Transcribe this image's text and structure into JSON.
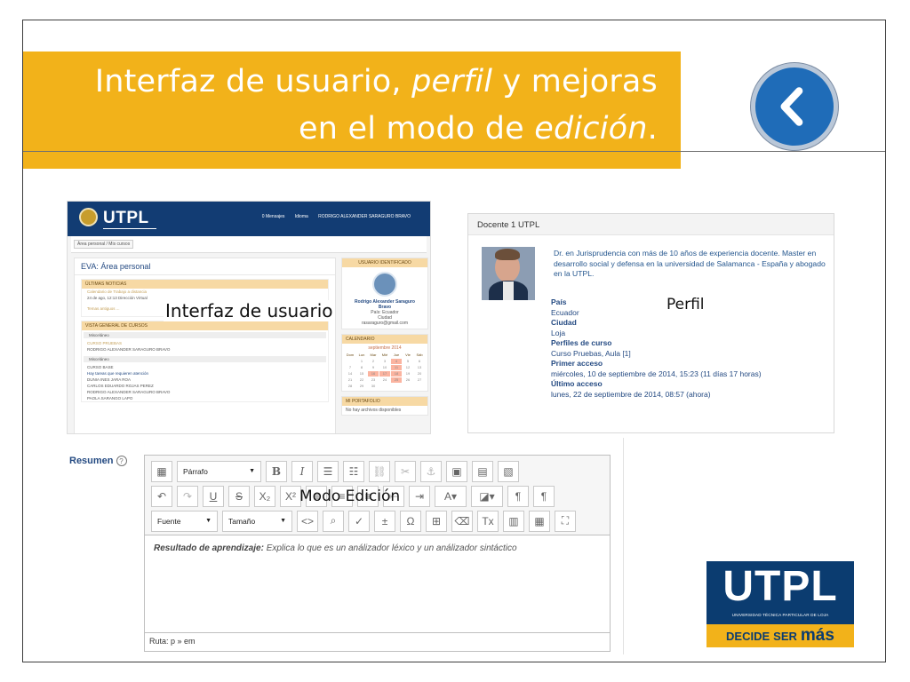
{
  "slide": {
    "title_line1_before_italic": "Interfaz de usuario, ",
    "title_line1_italic": "perfil",
    "title_line1_after_italic": " y mejoras",
    "title_line2_before_italic": "en el modo de ",
    "title_line2_italic": "edición",
    "title_line2_after_italic": ".",
    "back_icon": "chevron-left-icon",
    "accent": "#f2b21a",
    "brand_blue": "#0b3c70"
  },
  "screenshot_1": {
    "brand": "UTPL",
    "nav": [
      "0 Mensajes",
      "Idioma",
      "RODRIGO ALEXANDER SARAGURO BRAVO"
    ],
    "breadcrumb": "Área personal / Mis cursos",
    "page_title": "EVA: Área personal",
    "news_header": "ÚLTIMAS NOTICIAS",
    "news_items": [
      "Calendario de Trabajo a distancia",
      "24 de ago, 12:13  Dirección Virtual"
    ],
    "news_more": "Temas antiguos ...",
    "overview_header": "VISTA GENERAL DE CURSOS",
    "section_1": "Misceláneo",
    "course_1": "CURSO PRUEBAS",
    "teacher_1": "RODRIGO ALEXANDER SARAGURO BRAVO",
    "section_2": "Misceláneo",
    "course_2": "CURSO BASE",
    "tasks_notice": "Hay tareas que requieren atención",
    "students": [
      "DUNIA INES JARA ROA",
      "CARLOS EDUARDO ROJAS PEREZ",
      "RODRIGO ALEXANDER SARAGURO BRAVO",
      "PAOLA SARANGO LAPO"
    ],
    "user_header": "USUARIO IDENTIFICADO",
    "user_name_1": "Rodrigo Alexander Saraguro",
    "user_name_2": "Bravo",
    "user_country": "País: Ecuador",
    "user_city": "Ciudad",
    "user_email": "rasaraguro@gmail.com",
    "calendar_header": "CALENDARIO",
    "calendar_month": "septiembre 2014",
    "calendar_days": [
      "Dom",
      "Lun",
      "Mar",
      "Mié",
      "Jue",
      "Vie",
      "Sáb"
    ],
    "calendar_rows": [
      [
        "",
        "1",
        "2",
        "3",
        "4",
        "5",
        "6"
      ],
      [
        "7",
        "8",
        "9",
        "10",
        "11",
        "12",
        "13"
      ],
      [
        "14",
        "15",
        "16",
        "17",
        "18",
        "19",
        "20"
      ],
      [
        "21",
        "22",
        "23",
        "24",
        "25",
        "26",
        "27"
      ],
      [
        "28",
        "29",
        "30",
        "",
        "",
        "",
        ""
      ]
    ],
    "portfolio_header": "MI PORTAFOLIO",
    "portfolio_empty": "No hay archivos disponibles",
    "caption": "Interfaz de usuario"
  },
  "screenshot_2": {
    "title": "Docente 1 UTPL",
    "bio": "Dr. en Jurisprudencia con más de 10 años de experiencia docente. Master en desarrollo social y defensa en la universidad de Salamanca - España y abogado en la UTPL.",
    "caption": "Perfil",
    "fields": [
      {
        "label": "País",
        "value": "Ecuador"
      },
      {
        "label": "Ciudad",
        "value": "Loja"
      },
      {
        "label": "Perfiles de curso",
        "value": "Curso Pruebas, Aula [1]"
      },
      {
        "label": "Primer acceso",
        "value": "miércoles, 10 de septiembre de 2014, 15:23  (11 días 17 horas)"
      },
      {
        "label": "Último acceso",
        "value": "lunes, 22 de septiembre de 2014, 08:57  (ahora)"
      }
    ]
  },
  "editor": {
    "field_label": "Resumen",
    "help_icon": "question-circle-icon",
    "format_select": "Párrafo",
    "font_select": "Fuente",
    "size_select": "Tamaño",
    "content_label": "Resultado de aprendizaje:",
    "content_text": " Explica lo que es un análizador léxico y un análizador  sintáctico",
    "caption": "Modo Edición",
    "path": "Ruta: p » em"
  },
  "logo": {
    "name": "UTPL",
    "subtitle": "UNIVERSIDAD TÉCNICA PARTICULAR DE LOJA",
    "slogan_1": "DECIDE",
    "slogan_2": "SER",
    "slogan_3": "más"
  }
}
